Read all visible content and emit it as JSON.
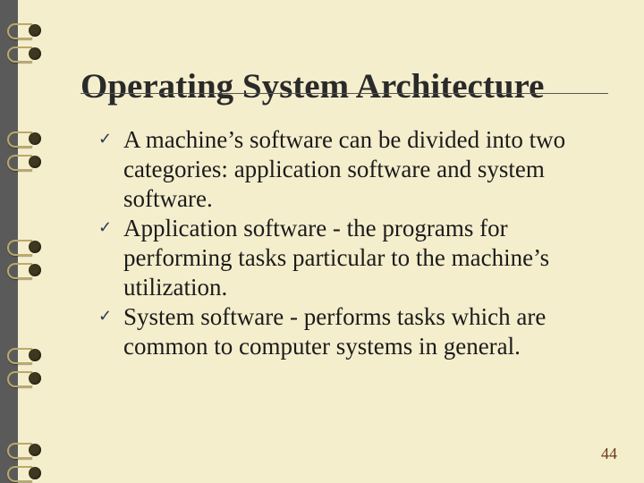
{
  "slide": {
    "title": "Operating System Architecture",
    "bullets": [
      "A machine’s software can be divided into two categories: application software and system software.",
      "Application software - the programs for performing  tasks particular to the machine’s utilization.",
      "System software - performs tasks which are common to computer systems in general."
    ],
    "page_number": "44"
  },
  "icons": {
    "checkmark": "✓"
  }
}
